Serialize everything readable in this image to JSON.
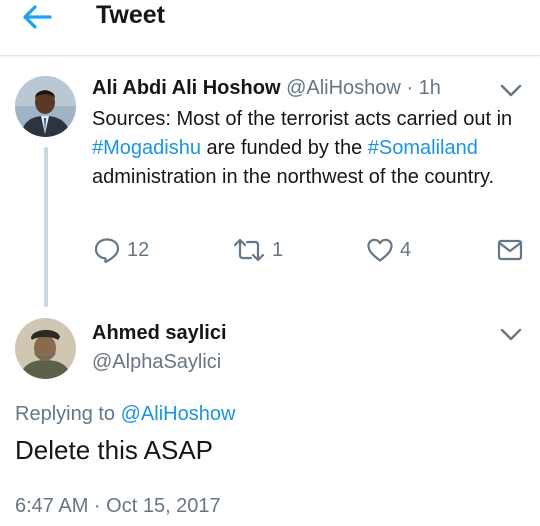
{
  "header": {
    "title": "Tweet"
  },
  "tweet": {
    "name": "Ali Abdi Ali Hoshow",
    "handle": "@AliHoshow",
    "separator": "·",
    "age": "1h",
    "body": {
      "part1": "Sources: Most of the terrorist acts carried out in ",
      "hashtag1": "#Mogadishu",
      "part2": " are funded by the ",
      "hashtag2": "#Somaliland",
      "part3": " administration in the northwest of the country."
    },
    "actions": {
      "replies": "12",
      "retweets": "1",
      "likes": "4"
    }
  },
  "reply": {
    "name": "Ahmed saylici",
    "handle": "@AlphaSaylici",
    "replying_label": "Replying to",
    "replying_to": "@AliHoshow",
    "text": "Delete this ASAP",
    "timestamp": "6:47 AM · Oct 15, 2017"
  },
  "colors": {
    "link": "#1b95e0",
    "secondary_text": "#657786",
    "primary_text": "#14171a",
    "thread_line": "#ccd6dd"
  },
  "icons": [
    "back-arrow-icon",
    "chevron-down-icon",
    "reply-icon",
    "retweet-icon",
    "heart-icon",
    "envelope-icon"
  ]
}
